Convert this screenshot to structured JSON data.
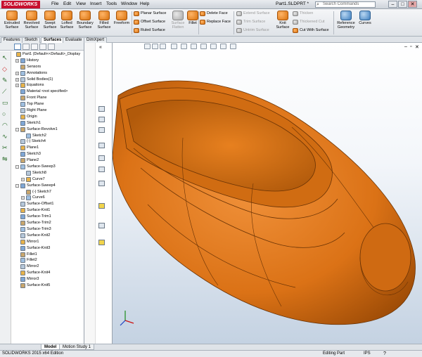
{
  "app": {
    "logo": "SOLIDWORKS",
    "doc_title": "Part1.SLDPRT *",
    "search_placeholder": "Search Commands"
  },
  "menu": [
    "File",
    "Edit",
    "View",
    "Insert",
    "Tools",
    "Window",
    "Help"
  ],
  "ribbon": {
    "big_buttons": [
      {
        "label": "Extruded\nSurface"
      },
      {
        "label": "Revolved\nSurface"
      },
      {
        "label": "Swept\nSurface"
      },
      {
        "label": "Lofted\nSurface"
      },
      {
        "label": "Boundary\nSurface"
      },
      {
        "label": "Filled\nSurface"
      },
      {
        "label": "Freeform"
      }
    ],
    "small_group1": [
      "Planar Surface",
      "Offset Surface",
      "Ruled Surface"
    ],
    "surface_flatten": "Surface\nFlatten",
    "fillet": "Fillet",
    "small_group2": [
      "Delete Face",
      "Replace Face"
    ],
    "small_group3": [
      "Extend Surface",
      "Trim Surface",
      "Untrim Surface"
    ],
    "knit_surface": "Knit\nSurface",
    "small_group4": [
      "Thicken",
      "Thickened Cut",
      "Cut With Surface"
    ],
    "reference_geometry": "Reference\nGeometry",
    "curves": "Curves"
  },
  "tabs": [
    "Features",
    "Sketch",
    "Surfaces",
    "Evaluate",
    "DimXpert"
  ],
  "active_tab": "Surfaces",
  "tree": [
    {
      "label": "Part1 (Default<<Default>_Display",
      "level": 0,
      "exp": ""
    },
    {
      "label": "History",
      "level": 1,
      "exp": "+"
    },
    {
      "label": "Sensors",
      "level": 1,
      "exp": ""
    },
    {
      "label": "Annotations",
      "level": 1,
      "exp": "+"
    },
    {
      "label": "Solid Bodies(1)",
      "level": 1,
      "exp": "+"
    },
    {
      "label": "Equations",
      "level": 1,
      "exp": "+"
    },
    {
      "label": "Material <not specified>",
      "level": 1,
      "exp": ""
    },
    {
      "label": "Front Plane",
      "level": 1,
      "exp": ""
    },
    {
      "label": "Top Plane",
      "level": 1,
      "exp": ""
    },
    {
      "label": "Right Plane",
      "level": 1,
      "exp": ""
    },
    {
      "label": "Origin",
      "level": 1,
      "exp": ""
    },
    {
      "label": "Sketch1",
      "level": 1,
      "exp": ""
    },
    {
      "label": "Surface-Revolve1",
      "level": 1,
      "exp": "-"
    },
    {
      "label": "Sketch2",
      "level": 2,
      "exp": ""
    },
    {
      "label": "(-) Sketch4",
      "level": 1,
      "exp": ""
    },
    {
      "label": "Plane1",
      "level": 1,
      "exp": ""
    },
    {
      "label": "Sketch3",
      "level": 1,
      "exp": ""
    },
    {
      "label": "Plane2",
      "level": 1,
      "exp": ""
    },
    {
      "label": "Surface-Sweep3",
      "level": 1,
      "exp": "-"
    },
    {
      "label": "Sketch8",
      "level": 2,
      "exp": ""
    },
    {
      "label": "Curve7",
      "level": 2,
      "exp": "+"
    },
    {
      "label": "Surface-Sweep4",
      "level": 1,
      "exp": "-"
    },
    {
      "label": "(-) Sketch7",
      "level": 2,
      "exp": ""
    },
    {
      "label": "Curve6",
      "level": 2,
      "exp": "+"
    },
    {
      "label": "Surface-Offset1",
      "level": 1,
      "exp": ""
    },
    {
      "label": "Surface-Knit1",
      "level": 1,
      "exp": ""
    },
    {
      "label": "Surface-Trim1",
      "level": 1,
      "exp": ""
    },
    {
      "label": "Surface-Trim2",
      "level": 1,
      "exp": ""
    },
    {
      "label": "Surface-Trim3",
      "level": 1,
      "exp": ""
    },
    {
      "label": "Surface-Knit2",
      "level": 1,
      "exp": ""
    },
    {
      "label": "Mirror1",
      "level": 1,
      "exp": ""
    },
    {
      "label": "Surface-Knit3",
      "level": 1,
      "exp": ""
    },
    {
      "label": "Fillet1",
      "level": 1,
      "exp": ""
    },
    {
      "label": "Fillet2",
      "level": 1,
      "exp": ""
    },
    {
      "label": "Mirror2",
      "level": 1,
      "exp": ""
    },
    {
      "label": "Surface-Knit4",
      "level": 1,
      "exp": ""
    },
    {
      "label": "Mirror3",
      "level": 1,
      "exp": ""
    },
    {
      "label": "Surface-Knit5",
      "level": 1,
      "exp": ""
    }
  ],
  "bottom_tabs": [
    "Model",
    "Motion Study 1"
  ],
  "status": {
    "left": "SOLIDWORKS 2015 x64 Edition",
    "mode": "Editing Part",
    "units": "IPS"
  },
  "colors": {
    "part_orange": "#e07a1f",
    "viewport_bottom": "#c4d2e2"
  }
}
